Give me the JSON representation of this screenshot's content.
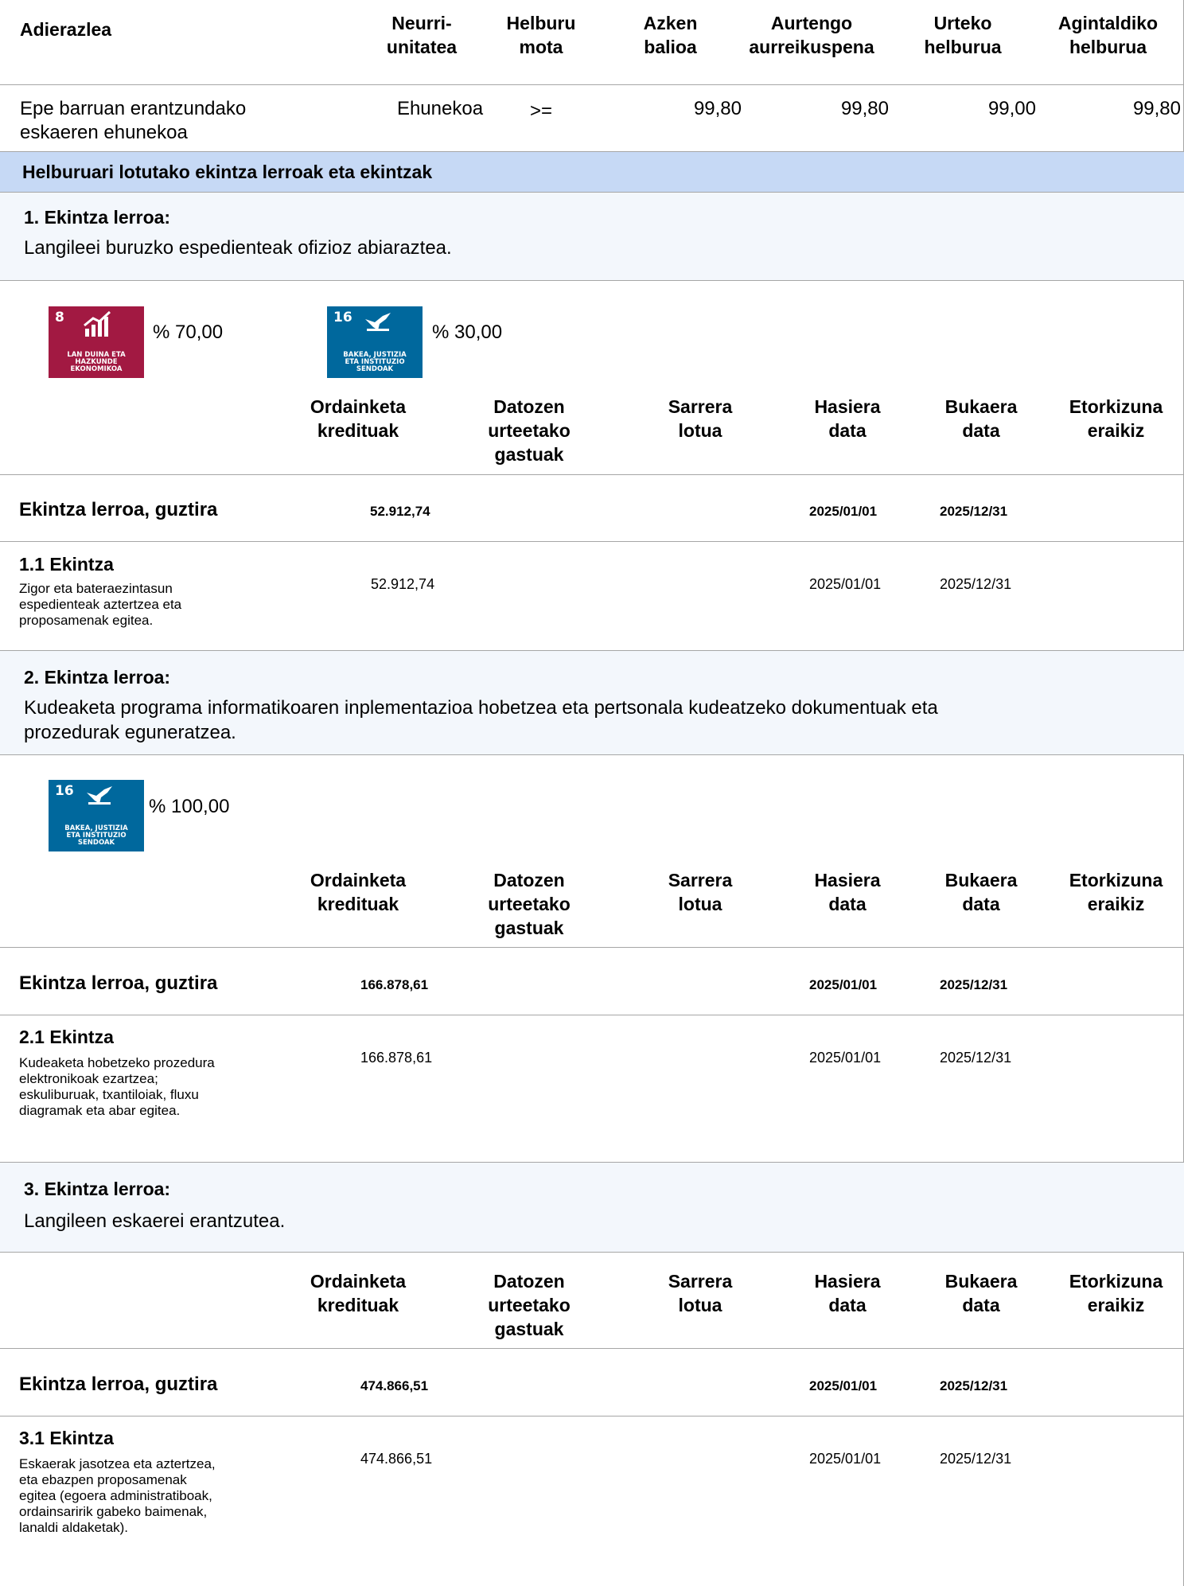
{
  "header": {
    "col_indicator": "Adierazlea",
    "col_unit_1": "Neurri-",
    "col_unit_2": "unitatea",
    "col_type_1": "Helburu",
    "col_type_2": "mota",
    "col_last_1": "Azken",
    "col_last_2": "balioa",
    "col_forecast_1": "Aurtengo",
    "col_forecast_2": "aurreikuspena",
    "col_annual_1": "Urteko",
    "col_annual_2": "helburua",
    "col_term_1": "Agintaldiko",
    "col_term_2": "helburua"
  },
  "indicator": {
    "name_1": "Epe barruan erantzundako",
    "name_2": "eskaeren ehunekoa",
    "unit": "Ehunekoa",
    "type": ">=",
    "last_value": "99,80",
    "forecast": "99,80",
    "annual_target": "99,00",
    "term_target": "99,80"
  },
  "section_title": "Helburuari lotutako ekintza lerroak eta ekintzak",
  "colheads": {
    "credits_1": "Ordainketa",
    "credits_2": "kredituak",
    "future_1": "Datozen",
    "future_2": "urteetako",
    "future_3": "gastuak",
    "income_1": "Sarrera",
    "income_2": "lotua",
    "start_1": "Hasiera",
    "start_2": "data",
    "end_1": "Bukaera",
    "end_2": "data",
    "future_build_1": "Etorkizuna",
    "future_build_2": "eraikiz"
  },
  "total_label": "Ekintza lerroa, guztira",
  "sdg": {
    "goal8_num": "8",
    "goal8_label_1": "LAN DUINA ETA",
    "goal8_label_2": "HAZKUNDE",
    "goal8_label_3": "EKONOMIKOA",
    "goal8_color": "#a21942",
    "goal16_num": "16",
    "goal16_label_1": "BAKEA, JUSTIZIA",
    "goal16_label_2": "ETA INSTITUZIO",
    "goal16_label_3": "SENDOAK",
    "goal16_color": "#00689d"
  },
  "lines": [
    {
      "title": "1. Ekintza lerroa:",
      "desc_1": "Langileei buruzko espedienteak ofizioz abiaraztea.",
      "sdg_pct_a": "% 70,00",
      "sdg_pct_b": "% 30,00",
      "total_credits": "52.912,74",
      "total_start": "2025/01/01",
      "total_end": "2025/12/31",
      "action_title": "1.1 Ekintza",
      "action_desc_1": "Zigor eta bateraezintasun",
      "action_desc_2": "espedienteak aztertzea eta",
      "action_desc_3": "proposamenak egitea.",
      "action_credits": "52.912,74",
      "action_start": "2025/01/01",
      "action_end": "2025/12/31"
    },
    {
      "title": "2. Ekintza lerroa:",
      "desc_1": "Kudeaketa programa informatikoaren inplementazioa hobetzea  eta  pertsonala kudeatzeko dokumentuak eta",
      "desc_2": "prozedurak eguneratzea.",
      "sdg_pct_a": "% 100,00",
      "total_credits": "166.878,61",
      "total_start": "2025/01/01",
      "total_end": "2025/12/31",
      "action_title": "2.1 Ekintza",
      "action_desc_1": "Kudeaketa hobetzeko prozedura",
      "action_desc_2": "elektronikoak ezartzea;",
      "action_desc_3": "eskuliburuak, txantiloiak, fluxu",
      "action_desc_4": "diagramak eta abar egitea.",
      "action_credits": "166.878,61",
      "action_start": "2025/01/01",
      "action_end": "2025/12/31"
    },
    {
      "title": "3. Ekintza lerroa:",
      "desc_1": "Langileen eskaerei erantzutea.",
      "total_credits": "474.866,51",
      "total_start": "2025/01/01",
      "total_end": "2025/12/31",
      "action_title": "3.1 Ekintza",
      "action_desc_1": "Eskaerak jasotzea eta aztertzea,",
      "action_desc_2": "eta ebazpen proposamenak",
      "action_desc_3": "egitea (egoera administratiboak,",
      "action_desc_4": "ordainsaririk gabeko baimenak,",
      "action_desc_5": "lanaldi aldaketak).",
      "action_credits": "474.866,51",
      "action_start": "2025/01/01",
      "action_end": "2025/12/31"
    }
  ]
}
